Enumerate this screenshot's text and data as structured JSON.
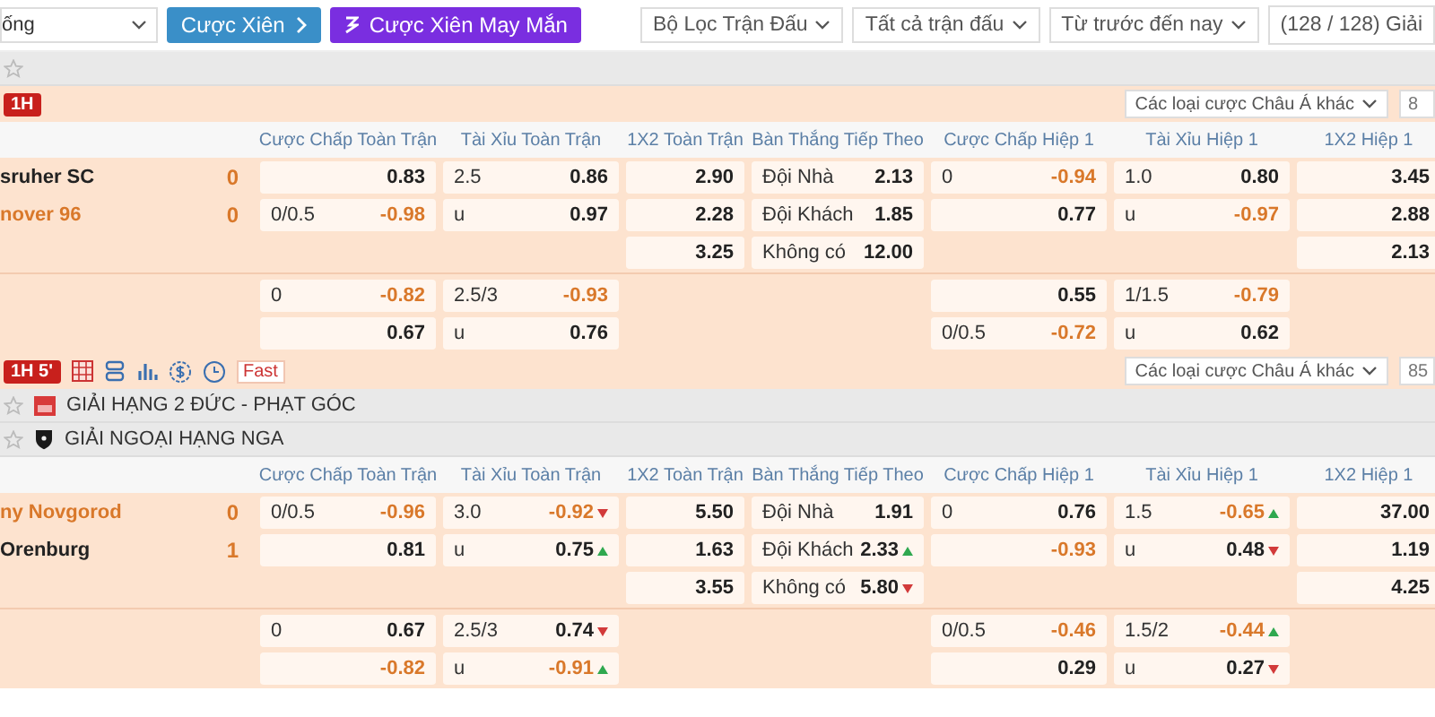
{
  "top_bar": {
    "sport_select": "ống",
    "buttons": [
      {
        "label": "Cược Xiên",
        "kind": "parlay"
      },
      {
        "label": "Cược Xiên May Mắn",
        "kind": "lucky"
      }
    ],
    "filters": [
      "Bộ Lọc Trận Đấu",
      "Tất cả trận đấu",
      "Từ trước đến nay"
    ],
    "league_count": "(128 / 128) Giải"
  },
  "blocks": [
    {
      "kind": "league"
    },
    {
      "kind": "toolbar",
      "badge": "1H",
      "more_bets": "Các loại cược Châu Á khác",
      "count": "8"
    },
    {
      "kind": "match",
      "columns": [
        "Cược Chấp Toàn Trận",
        "Tài Xỉu Toàn Trận",
        "1X2 Toàn Trận",
        "Bàn Thắng Tiếp Theo",
        "Cược Chấp Hiệp 1",
        "Tài Xỉu Hiệp 1",
        "1X2 Hiệp 1"
      ],
      "teams": [
        {
          "name": "sruher SC",
          "score": "0",
          "highlighted": false
        },
        {
          "name": "nover 96",
          "score": "0",
          "highlighted": true
        }
      ],
      "rows": [
        [
          {
            "odds": "0.83",
            "highlight": false
          },
          {
            "line": "2.5",
            "odds": "0.86",
            "highlight": false
          },
          {
            "odds": "2.90",
            "highlight": false
          },
          {
            "line": "Đội Nhà",
            "odds": "2.13",
            "highlight": false
          },
          {
            "line": "0",
            "odds": "-0.94",
            "highlight": true
          },
          {
            "line": "1.0",
            "odds": "0.80",
            "highlight": false
          },
          {
            "odds": "3.45",
            "highlight": false
          }
        ],
        [
          {
            "line": "0/0.5",
            "odds": "-0.98",
            "highlight": true
          },
          {
            "line": "u",
            "odds": "0.97",
            "highlight": false
          },
          {
            "odds": "2.28",
            "highlight": false
          },
          {
            "line": "Đội Khách",
            "odds": "1.85",
            "highlight": false
          },
          {
            "odds": "0.77",
            "highlight": false
          },
          {
            "line": "u",
            "odds": "-0.97",
            "highlight": true
          },
          {
            "odds": "2.88",
            "highlight": false
          }
        ],
        [
          null,
          null,
          {
            "odds": "3.25",
            "highlight": false
          },
          {
            "line": "Không có",
            "odds": "12.00",
            "highlight": false
          },
          null,
          null,
          {
            "odds": "2.13",
            "highlight": false
          }
        ]
      ],
      "extra_rows": [
        [
          {
            "line": "0",
            "odds": "-0.82",
            "highlight": true
          },
          {
            "line": "2.5/3",
            "odds": "-0.93",
            "highlight": true
          },
          null,
          null,
          {
            "odds": "0.55",
            "highlight": false
          },
          {
            "line": "1/1.5",
            "odds": "-0.79",
            "highlight": true
          },
          null
        ],
        [
          {
            "odds": "0.67",
            "highlight": false
          },
          {
            "line": "u",
            "odds": "0.76",
            "highlight": false
          },
          null,
          null,
          {
            "line": "0/0.5",
            "odds": "-0.72",
            "highlight": true
          },
          {
            "line": "u",
            "odds": "0.62",
            "highlight": false
          },
          null
        ]
      ]
    },
    {
      "kind": "toolbar",
      "badge": "1H 5'",
      "fast": "Fast",
      "more_bets": "Các loại cược Châu Á khác",
      "count": "85"
    },
    {
      "kind": "league",
      "name": "GIẢI HẠNG 2 ĐỨC - PHẠT GÓC",
      "emblem": {
        "kind": "flag"
      }
    },
    {
      "kind": "league",
      "name": "GIẢI NGOẠI HẠNG NGA",
      "emblem": {
        "kind": "shield"
      }
    },
    {
      "kind": "match",
      "columns": [
        "Cược Chấp Toàn Trận",
        "Tài Xỉu Toàn Trận",
        "1X2 Toàn Trận",
        "Bàn Thắng Tiếp Theo",
        "Cược Chấp Hiệp 1",
        "Tài Xỉu Hiệp 1",
        "1X2 Hiệp 1"
      ],
      "teams": [
        {
          "name": "ny Novgorod",
          "score": "0",
          "highlighted": true
        },
        {
          "name": "Orenburg",
          "score": "1",
          "highlighted": false
        }
      ],
      "rows": [
        [
          {
            "line": "0/0.5",
            "odds": "-0.96",
            "highlight": true
          },
          {
            "line": "3.0",
            "odds": "-0.92",
            "highlight": true,
            "rising": false
          },
          {
            "odds": "5.50",
            "highlight": false
          },
          {
            "line": "Đội Nhà",
            "odds": "1.91",
            "highlight": false
          },
          {
            "line": "0",
            "odds": "0.76",
            "highlight": false
          },
          {
            "line": "1.5",
            "odds": "-0.65",
            "highlight": true,
            "rising": true
          },
          {
            "odds": "37.00",
            "highlight": false
          }
        ],
        [
          {
            "odds": "0.81",
            "highlight": false
          },
          {
            "line": "u",
            "odds": "0.75",
            "highlight": false,
            "rising": true
          },
          {
            "odds": "1.63",
            "highlight": false
          },
          {
            "line": "Đội Khách",
            "odds": "2.33",
            "highlight": false,
            "rising": true
          },
          {
            "odds": "-0.93",
            "highlight": true
          },
          {
            "line": "u",
            "odds": "0.48",
            "highlight": false,
            "rising": false
          },
          {
            "odds": "1.19",
            "highlight": false
          }
        ],
        [
          null,
          null,
          {
            "odds": "3.55",
            "highlight": false
          },
          {
            "line": "Không có",
            "odds": "5.80",
            "highlight": false,
            "rising": false
          },
          null,
          null,
          {
            "odds": "4.25",
            "highlight": false
          }
        ]
      ],
      "extra_rows": [
        [
          {
            "line": "0",
            "odds": "0.67",
            "highlight": false
          },
          {
            "line": "2.5/3",
            "odds": "0.74",
            "highlight": false,
            "rising": false
          },
          null,
          null,
          {
            "line": "0/0.5",
            "odds": "-0.46",
            "highlight": true
          },
          {
            "line": "1.5/2",
            "odds": "-0.44",
            "highlight": true,
            "rising": true
          },
          null
        ],
        [
          {
            "odds": "-0.82",
            "highlight": true
          },
          {
            "line": "u",
            "odds": "-0.91",
            "highlight": true,
            "rising": true
          },
          null,
          null,
          {
            "odds": "0.29",
            "highlight": false
          },
          {
            "line": "u",
            "odds": "0.27",
            "highlight": false,
            "rising": false
          },
          null
        ]
      ]
    }
  ]
}
